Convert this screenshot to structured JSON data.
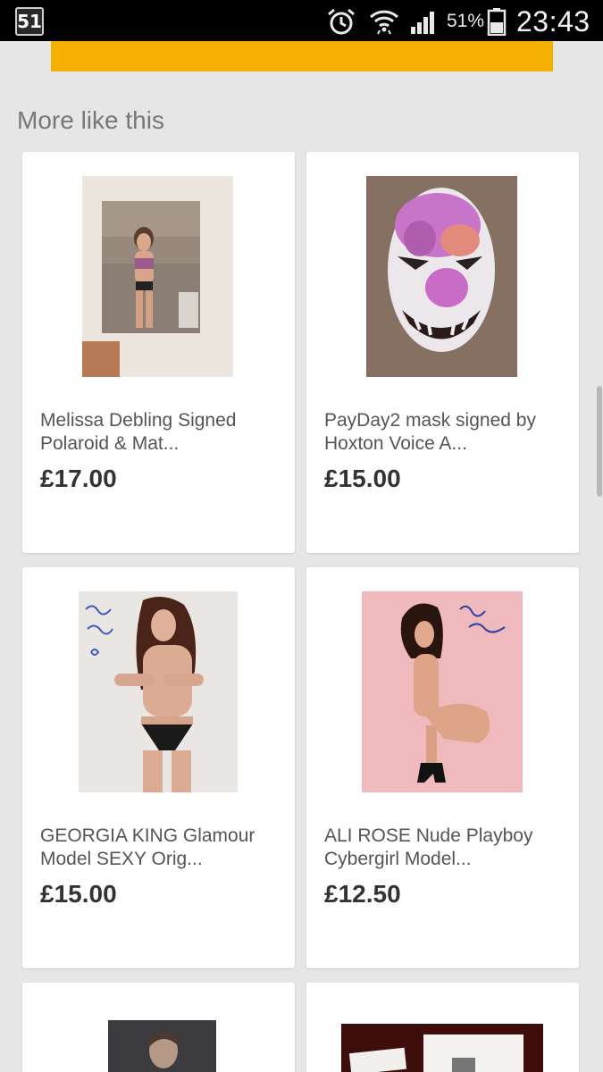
{
  "status_bar": {
    "notification_count": "51",
    "battery_percent": "51%",
    "time": "23:43"
  },
  "section": {
    "title": "More like this"
  },
  "items": [
    {
      "title_line1": "Melissa Debling Signed",
      "title_line2": "Polaroid & Mat...",
      "price": "£17.00"
    },
    {
      "title_line1": "PayDay2 mask signed by",
      "title_line2": "Hoxton Voice A...",
      "price": "£15.00"
    },
    {
      "title_line1": "GEORGIA KING Glamour",
      "title_line2": "Model SEXY Orig...",
      "price": "£15.00"
    },
    {
      "title_line1": "ALI ROSE Nude Playboy",
      "title_line2": "Cybergirl Model...",
      "price": "£12.50"
    }
  ],
  "colors": {
    "banner": "#f5af02",
    "background": "#e6e6e6",
    "card": "#ffffff"
  },
  "icons": [
    "notification-badge-icon",
    "alarm-icon",
    "wifi-icon",
    "signal-icon",
    "battery-icon"
  ]
}
